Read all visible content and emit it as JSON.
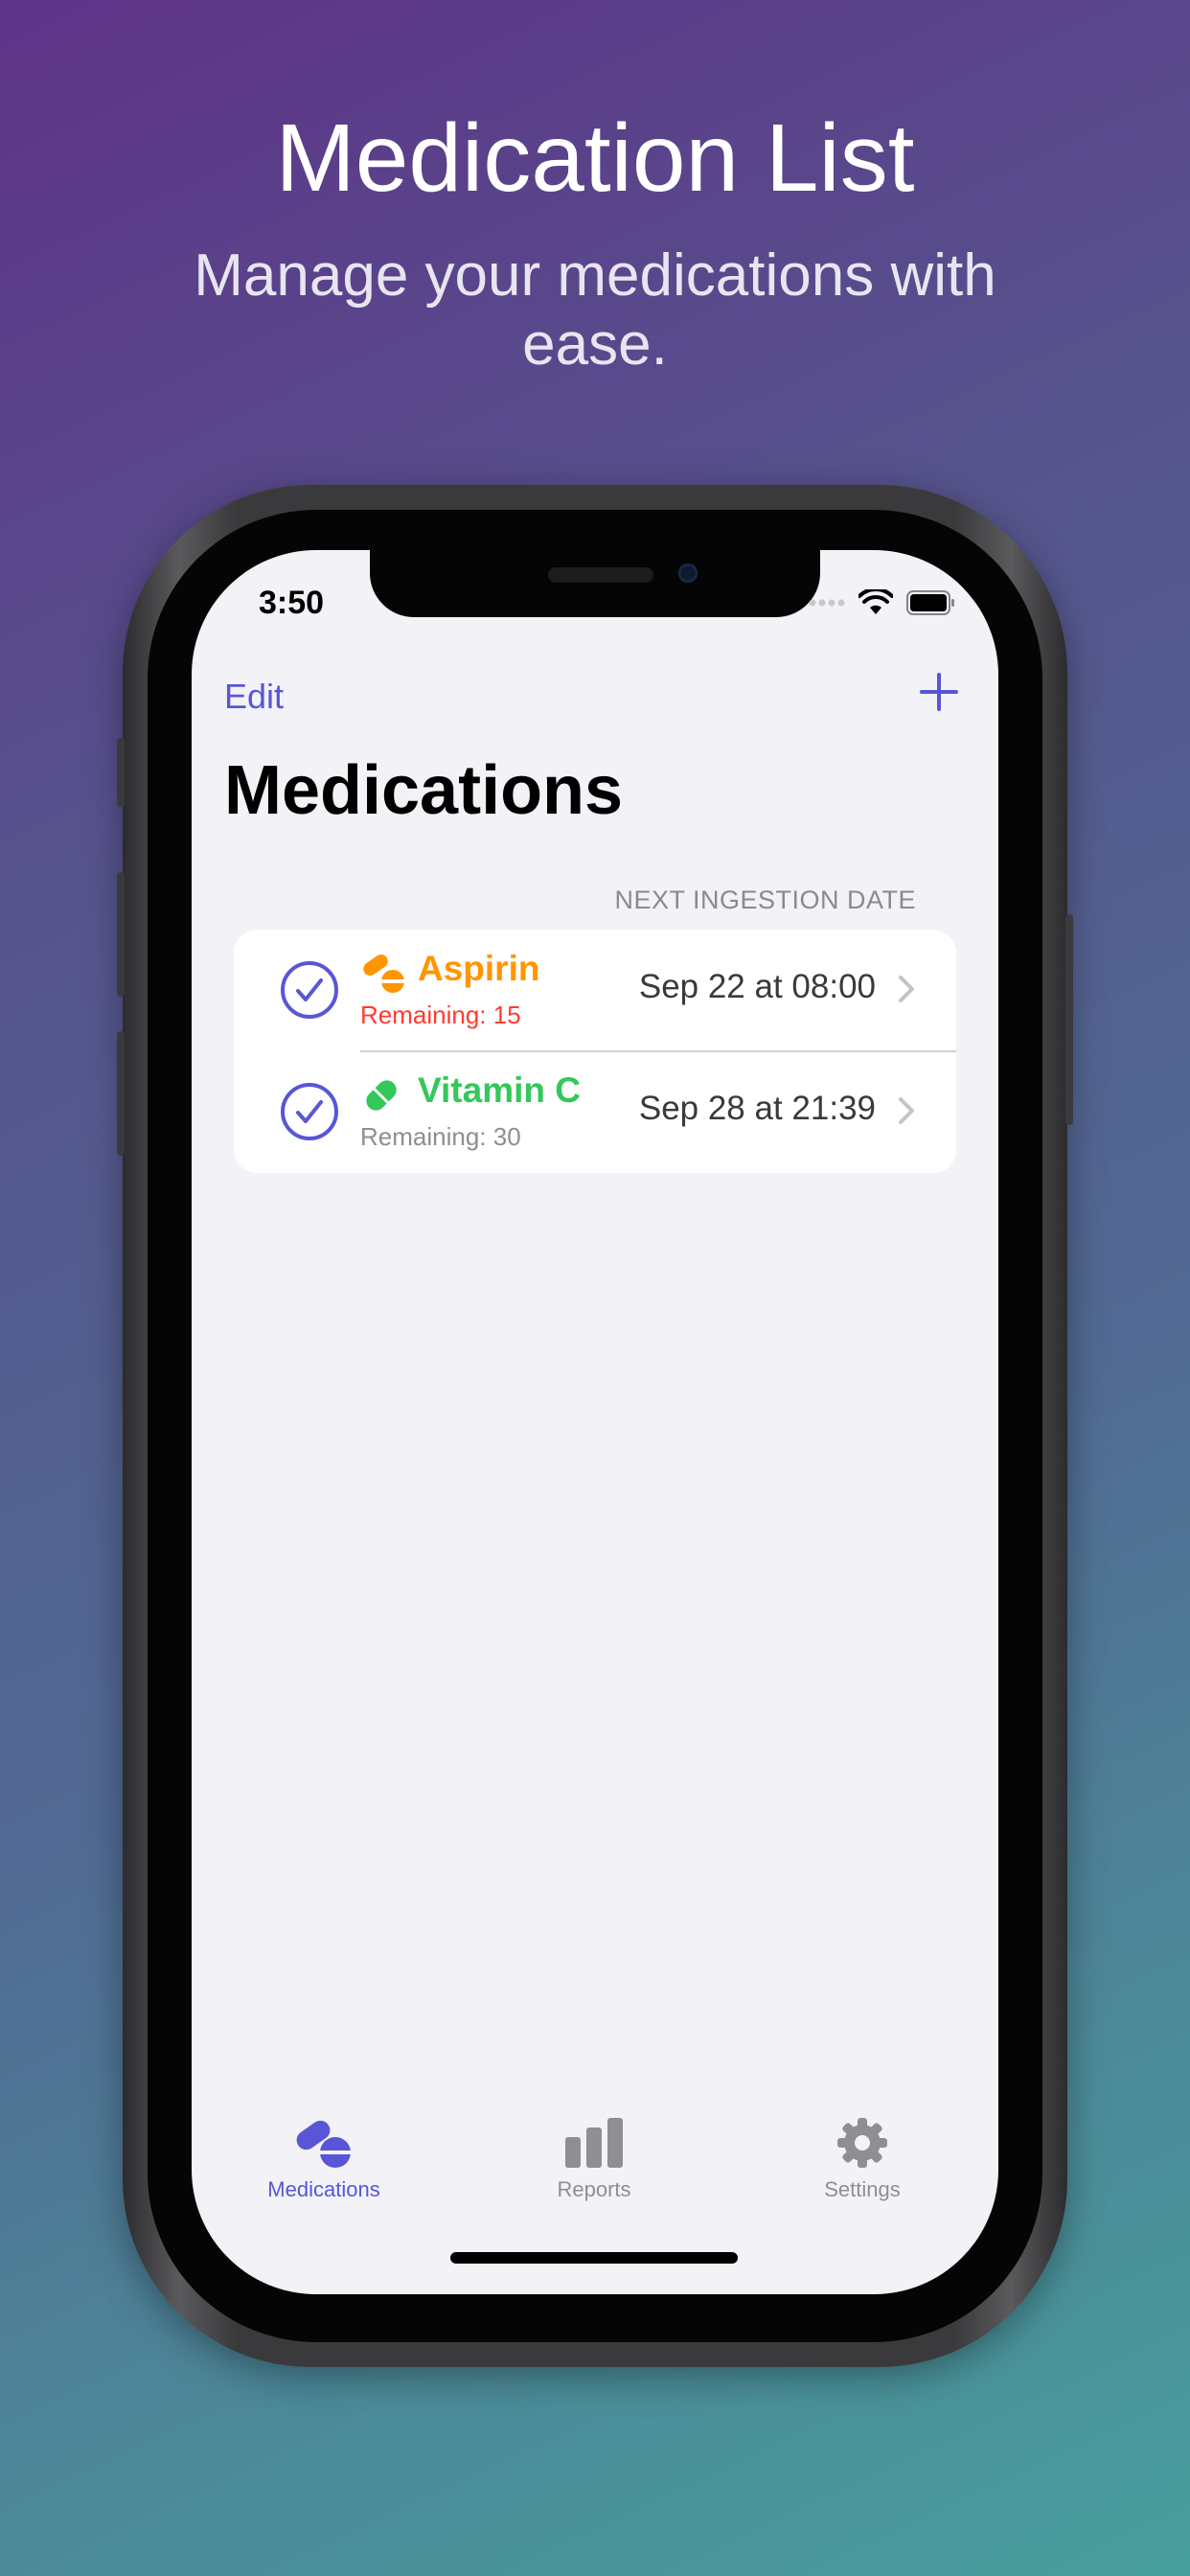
{
  "promo": {
    "title": "Medication List",
    "subtitle": "Manage your medications with ease."
  },
  "status_bar": {
    "time": "3:50",
    "icons": [
      "signal-dots-icon",
      "wifi-icon",
      "battery-icon"
    ]
  },
  "nav": {
    "edit_label": "Edit",
    "add_icon": "plus-icon",
    "title": "Medications"
  },
  "list": {
    "section_header": "NEXT INGESTION DATE",
    "items": [
      {
        "name": "Aspirin",
        "remaining": "Remaining: 15",
        "next_date": "Sep 22 at 08:00",
        "name_color": "#ff9500",
        "remaining_color": "#ff3b30",
        "icon": "pills-icon"
      },
      {
        "name": "Vitamin C",
        "remaining": "Remaining: 30",
        "next_date": "Sep 28 at 21:39",
        "name_color": "#34c759",
        "remaining_color": "#8e8e93",
        "icon": "capsule-icon"
      }
    ]
  },
  "tabs": [
    {
      "label": "Medications",
      "icon": "pills-icon",
      "active": true
    },
    {
      "label": "Reports",
      "icon": "bar-chart-icon",
      "active": false
    },
    {
      "label": "Settings",
      "icon": "gear-icon",
      "active": false
    }
  ],
  "colors": {
    "accent": "#5856d6",
    "inactive_tab": "#8e8e93",
    "background": "#f2f2f7"
  }
}
